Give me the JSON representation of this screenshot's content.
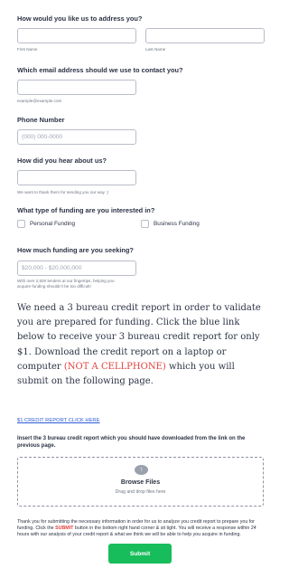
{
  "name_section": {
    "question": "How would you like us to address you?",
    "first_label": "First Name",
    "last_label": "Last Name"
  },
  "email_section": {
    "question": "Which email address should we use to contact you?",
    "hint": "example@example.com"
  },
  "phone_section": {
    "question": "Phone Number",
    "placeholder": "(000) 000-0000"
  },
  "hear_section": {
    "question": "How did you hear about us?",
    "hint": "We want to thank them for sending you our way :)"
  },
  "funding_type_section": {
    "question": "What type of funding are you interested in?",
    "option_personal": "Personal Funding",
    "option_business": "Business Funding"
  },
  "amount_section": {
    "question": "How much funding are you seeking?",
    "placeholder": "$20,000 - $20,000,000",
    "hint_line1": "With over 2,500 lenders at our fingertips, helping you",
    "hint_line2": "acquire funding shouldn't be too difficult!"
  },
  "credit_paragraph": {
    "text_before": "We need a 3 bureau credit report in order to validate you are prepared for funding. Click the blue link below to receive your 3 bureau credit report for only $1. Download the credit report on a laptop or computer ",
    "warning": "(NOT A CELLPHONE)",
    "text_after": " which you will submit on the following page."
  },
  "credit_link": {
    "label": "$1 CREDIT REPORT CLICK HERE"
  },
  "upload_section": {
    "question": "Insert the 3 bureau credit report which you should have downloaded from the link on the previous page.",
    "browse_label": "Browse Files",
    "drag_label": "Drag and drop files here"
  },
  "thanks_paragraph": {
    "text_before": "Thank you for submitting the necessary information in order for us to analyze you credit report to prepare you for funding. Click the ",
    "submit_word": "SUBMIT",
    "text_after": " button in the bottom right hand corner & sit tight. You will receive a response within 24 hours with our analysis of your credit report & what we think we will be able to help you acquire in funding."
  },
  "submit_button": {
    "label": "Submit"
  },
  "colors": {
    "accent_green": "#18bd5b",
    "warning_red": "#e2403f",
    "link_blue": "#2a5bd7"
  },
  "icons": {
    "upload": "cloud-upload-icon"
  }
}
